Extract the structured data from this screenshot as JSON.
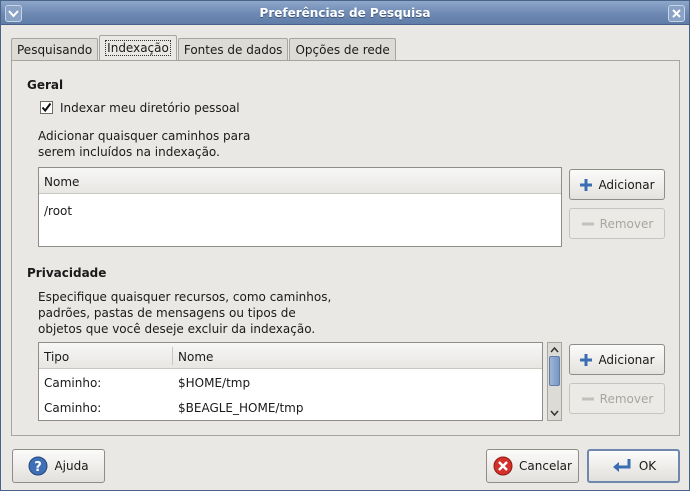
{
  "window": {
    "title": "Preferências de Pesquisa"
  },
  "tabs": [
    {
      "label": "Pesquisando"
    },
    {
      "label": "Indexação"
    },
    {
      "label": "Fontes de dados"
    },
    {
      "label": "Opções de rede"
    }
  ],
  "geral": {
    "title": "Geral",
    "checkbox_label": "Indexar meu diretório pessoal",
    "checkbox_checked": true,
    "description_line1": "Adicionar quaisquer caminhos para",
    "description_line2": "serem incluídos na indexação.",
    "list_header": "Nome",
    "rows": [
      "/root"
    ],
    "add_button": "Adicionar",
    "remove_button": "Remover"
  },
  "privacidade": {
    "title": "Privacidade",
    "description_line1": "Especifique quaisquer recursos, como caminhos,",
    "description_line2": "padrões, pastas de mensagens ou tipos de",
    "description_line3": "objetos que você deseje excluir da indexação.",
    "col_tipo": "Tipo",
    "col_nome": "Nome",
    "rows": [
      {
        "tipo": "Caminho:",
        "nome": "$HOME/tmp"
      },
      {
        "tipo": "Caminho:",
        "nome": "$BEAGLE_HOME/tmp"
      }
    ],
    "add_button": "Adicionar",
    "remove_button": "Remover"
  },
  "footer": {
    "help_button": "Ajuda",
    "cancel_button": "Cancelar",
    "ok_button": "OK"
  }
}
